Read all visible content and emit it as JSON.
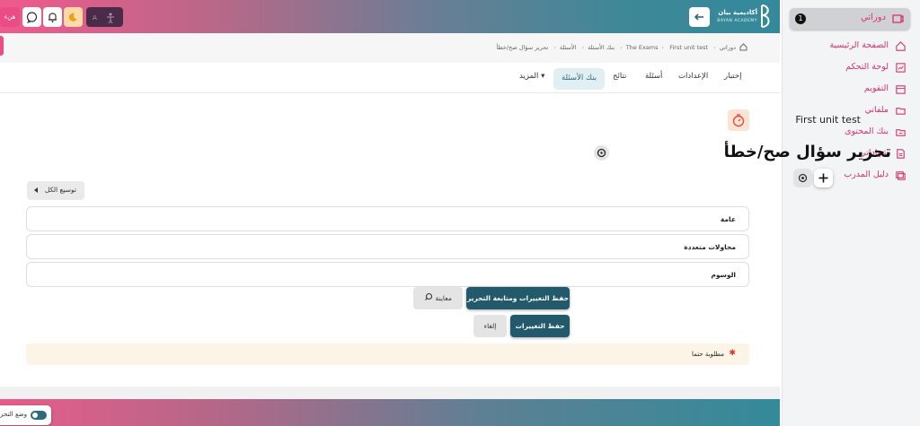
{
  "sidebar": {
    "active": {
      "label": "دوراتي",
      "badge": "1"
    },
    "items": [
      {
        "label": "الصفحة الرئيسية",
        "icon": "home-icon"
      },
      {
        "label": "لوحة التحكم",
        "icon": "dashboard-icon"
      },
      {
        "label": "التقويم",
        "icon": "calendar-icon"
      },
      {
        "label": "ملفاتي",
        "icon": "folder-icon"
      },
      {
        "label": "بنك المحتوى",
        "icon": "content-bank-icon"
      },
      {
        "label": "شهاداتي",
        "icon": "certificate-icon"
      },
      {
        "label": "دليل المدرب",
        "icon": "trainer-guide-icon"
      }
    ]
  },
  "topbar": {
    "brand_ar": "أكاديمية بيان",
    "brand_en": "BAYAN ACADEMY",
    "user_button": "هنء"
  },
  "breadcrumb": [
    "دوراتي",
    "The Exams",
    "First unit test",
    "بنك الأسئلة",
    "الأسئلة",
    "تحرير سؤال صح/خطأ"
  ],
  "tabs": [
    {
      "label": "إختبار",
      "active": false
    },
    {
      "label": "الإعدادات",
      "active": false
    },
    {
      "label": "أسئلة",
      "active": false
    },
    {
      "label": "نتائج",
      "active": false
    },
    {
      "label": "بنك الأسئلة",
      "active": true
    },
    {
      "label": "المزيد ▾",
      "active": false
    }
  ],
  "quiz_name": "First unit test",
  "page_title": "تحرير سؤال صح/خطأ",
  "expand_all": "توسيع الكل",
  "sections": [
    "عامة",
    "محاولات متعددة",
    "الوسوم"
  ],
  "buttons": {
    "save_continue": "حفظ التغييرات ومتابعة التحرير",
    "preview": "معاينة",
    "save": "حفظ التغييرات",
    "cancel": "إلغاء"
  },
  "required_notice": "مطلوبة حتما",
  "footer": {
    "edit_mode": "وضع التحرير"
  },
  "colors": {
    "accent": "#22596b",
    "pink": "#ea4c86",
    "teal": "#33899a"
  }
}
